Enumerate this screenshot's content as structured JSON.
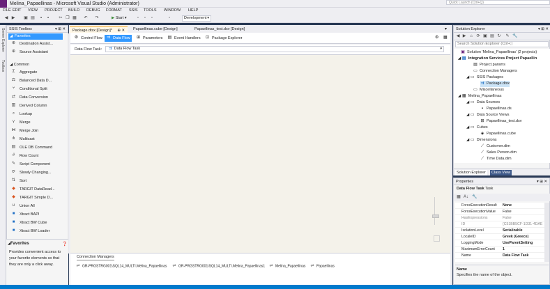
{
  "window": {
    "title": "Melina_Papaellinas - Microsoft Visual Studio (Administrator)",
    "quick_launch": "Quick Launch (Ctrl+Q)"
  },
  "menu": [
    "FILE",
    "EDIT",
    "VIEW",
    "PROJECT",
    "BUILD",
    "DEBUG",
    "FORMAT",
    "SSIS",
    "TOOLS",
    "WINDOW",
    "HELP"
  ],
  "toolbar": {
    "start_label": "Start",
    "config": "Development"
  },
  "left_strip": [
    "Server Explorer",
    "Toolbox"
  ],
  "toolbox": {
    "title": "SSIS Toolbox",
    "favorites_label": "Favorites",
    "favorites": [
      "Destination Assist...",
      "Source Assistant"
    ],
    "common_label": "Common",
    "common": [
      "Aggregate",
      "Balanced Data D...",
      "Conditional Split",
      "Data Conversion",
      "Derived Column",
      "Lookup",
      "Merge",
      "Merge Join",
      "Multicast",
      "OLE DB Command",
      "Row Count",
      "Script Component",
      "Slowly Changing...",
      "Sort",
      "TARGIT DataRead...",
      "TARGIT Simple D...",
      "Union All",
      "Xtract BAPI",
      "Xtract BW Cube",
      "Xtract BW Loader"
    ]
  },
  "fav_panel": {
    "title": "Favorites",
    "text": "Provides convenient access to your favorite elements so that they are only a click away."
  },
  "doc_tabs": [
    "Package.dtsx [Design]*",
    "Papaellinas.cube [Design]",
    "Papaellinas_test.dsv [Design]"
  ],
  "design_tabs": [
    "Control Flow",
    "Data Flow",
    "Parameters",
    "Event Handlers",
    "Package Explorer"
  ],
  "data_flow_task": {
    "label": "Data Flow Task:",
    "value": "Data Flow Task"
  },
  "connection_managers": {
    "tab": "Connection Managers",
    "items": [
      "GR-PRGSTRG001\\SQL14_MULTI.Melina_Papaellinas",
      "GR-PRGSTRG001\\SQL14_MULTI.Melina_Papaellinas1",
      "Melina_Papaellinas",
      "Papaellinas"
    ]
  },
  "solution_explorer": {
    "title": "Solution Explorer",
    "search_placeholder": "Search Solution Explorer (Ctrl+;)",
    "nodes": [
      "Solution 'Melina_Papaellinas' (2 projects)",
      "Integration Services Project Papaellin",
      "Project.params",
      "Connection Managers",
      "SSIS Packages",
      "Package.dtsx",
      "Miscellaneous",
      "Melina_Papaellinas",
      "Data Sources",
      "Papaellinas.ds",
      "Data Source Views",
      "Papaellinas_test.dsv",
      "Cubes",
      "Papaellinas.cube",
      "Dimensions",
      "Customer.dim",
      "Sales Person.dim",
      "Time Data.dim"
    ],
    "tabs": [
      "Solution Explorer",
      "Class View"
    ]
  },
  "properties": {
    "title": "Properties",
    "object": "Data Flow Task",
    "object_type": "Task",
    "rows": [
      {
        "name": "ForceExecutionResult",
        "value": "None"
      },
      {
        "name": "ForceExecutionValue",
        "value": "False"
      },
      {
        "name": "HasExpressions",
        "value": "False"
      },
      {
        "name": "ID",
        "value": "{C51BB5CF-1D31-4DAE"
      },
      {
        "name": "IsolationLevel",
        "value": "Serializable"
      },
      {
        "name": "LocaleID",
        "value": "Greek (Greece)"
      },
      {
        "name": "LoggingMode",
        "value": "UseParentSetting"
      },
      {
        "name": "MaximumErrorCount",
        "value": "1"
      },
      {
        "name": "Name",
        "value": "Data Flow Task"
      }
    ],
    "desc_title": "Name",
    "desc_text": "Specifies the name of the object."
  }
}
